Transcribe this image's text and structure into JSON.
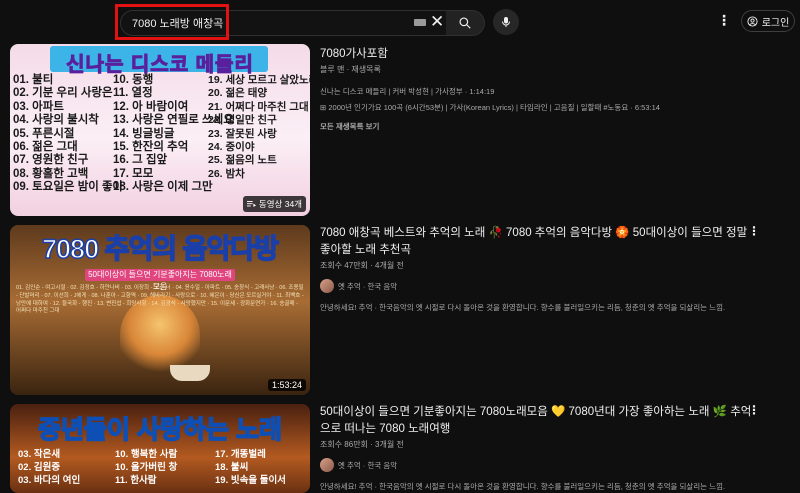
{
  "search": {
    "query": "7080 노래방 애창곡"
  },
  "header": {
    "login_label": "로그인"
  },
  "icons": {
    "keyboard": "keyboard-icon",
    "clear": "close-icon",
    "search": "search-icon",
    "mic": "mic-icon",
    "more": "more-vert-icon",
    "account": "account-circle-icon",
    "playlist": "playlist-icon"
  },
  "results": [
    {
      "thumb_title": "신나는 디스코 메들리",
      "thumb_songs_col1": [
        "01. 불티",
        "02. 기분 우리 사랑은",
        "03. 아파트",
        "04. 사랑의 불시착",
        "05. 푸른시절",
        "06. 젊은 그대",
        "07. 영원한 친구",
        "08. 황홀한 고백",
        "09. 토요일은 밤이 좋아"
      ],
      "thumb_songs_col2": [
        "10. 동행",
        "11. 열정",
        "12. 아 바람이여",
        "13. 사랑은 연필로 쓰세요",
        "14. 빙글빙글",
        "15. 한잔의 추억",
        "16. 그 집앞",
        "17. 모모",
        "18. 사랑은 이제 그만"
      ],
      "thumb_songs_col3": [
        "19. 세상 모르고 살았노라",
        "20. 젊은 태양",
        "21. 어쩌다 마주친 그대",
        "22. 영일만 친구",
        "23. 잘못된 사랑",
        "24. 중이야",
        "25. 젊음의 노트",
        "26. 밤차"
      ],
      "badge": "동영상 34개",
      "title": "7080가사포함",
      "meta": "블루 맨 · 재생목록",
      "desc_line1": "신나는 디스코 메들리 | 커버 박성현 | 가사정부 · 1:14:19",
      "desc_line2": "2000년 인기가요 100곡 (6시간53분) | 가사(Korean Lyrics) | 타임라인 | 고음질 | 일할때 #노동요 · 6:53:14",
      "link": "모든 재생목록 보기"
    },
    {
      "thumb_title": "7080 추억의 음악다방",
      "thumb_sub": "50대이상이 들으면 기분좋아지는 7080노래모음",
      "thumb_list": "01. 김인순 - 여고시절 · 02. 김정호 - 하얀나비 · 03. 이장희 - 그건 너 · 04. 윤수일 - 아파트 · 05. 송창식 - 고래사냥 · 06. 조용필 - 단발머리 · 07. 이선희 - J에게 · 08. 나훈아 - 고향역 · 09. 해바라기 - 사랑으로 · 10. 혜은이 - 당신은 모르실거야 · 11. 최백호 - 낭만에 대하여 · 12. 들국화 - 행진 · 13. 변진섭 - 희망사항 · 14. 김광석 - 사랑했지만 · 15. 이문세 - 광화문연가 · 16. 송골매 - 어쩌다 마주친 그대",
      "duration": "1:53:24",
      "title": "7080 애창곡 베스트와 추억의 노래 🥀 7080 추억의 음악다방 🏵️ 50대이상이 들으면 정말 좋아할 노래 추천곡",
      "meta": "조회수 47만회 · 4개월 전",
      "channel": "옛 추억 · 한국 음악",
      "desc": "안녕하세요! 추억 · 한국음악의 옛 시절로 다시 돌아온 것을 환영합니다. 향수를 불러일으키는 리듬, 청춘의 옛 추억을 되살리는 느낌."
    },
    {
      "thumb_title": "중년들이 사랑하는 노래",
      "thumb_songs_col1": [
        "03. 작은새",
        "02. 김원중",
        "03. 바다의 여인"
      ],
      "thumb_songs_col2": [
        "10. 행복한 사람",
        "10. 올가버린 창",
        "11. 한사람"
      ],
      "thumb_songs_col3": [
        "17. 개똥벌레",
        "18. 불씨",
        "19. 빗속을 둘이서"
      ],
      "title": "50대이상이 들으면 기분좋아지는 7080노래모음 💛 7080년대 가장 좋아하는 노래 🌿 추억으로 떠나는 7080 노래여행",
      "meta": "조회수 86만회 · 3개월 전",
      "channel": "옛 추억 · 한국 음악",
      "desc": "안녕하세요! 추억 · 한국음악의 옛 시절로 다시 돌아온 것을 환영합니다. 향수를 불러일으키는 리듬, 청춘의 옛 추억을 되살리는 느낌."
    }
  ]
}
